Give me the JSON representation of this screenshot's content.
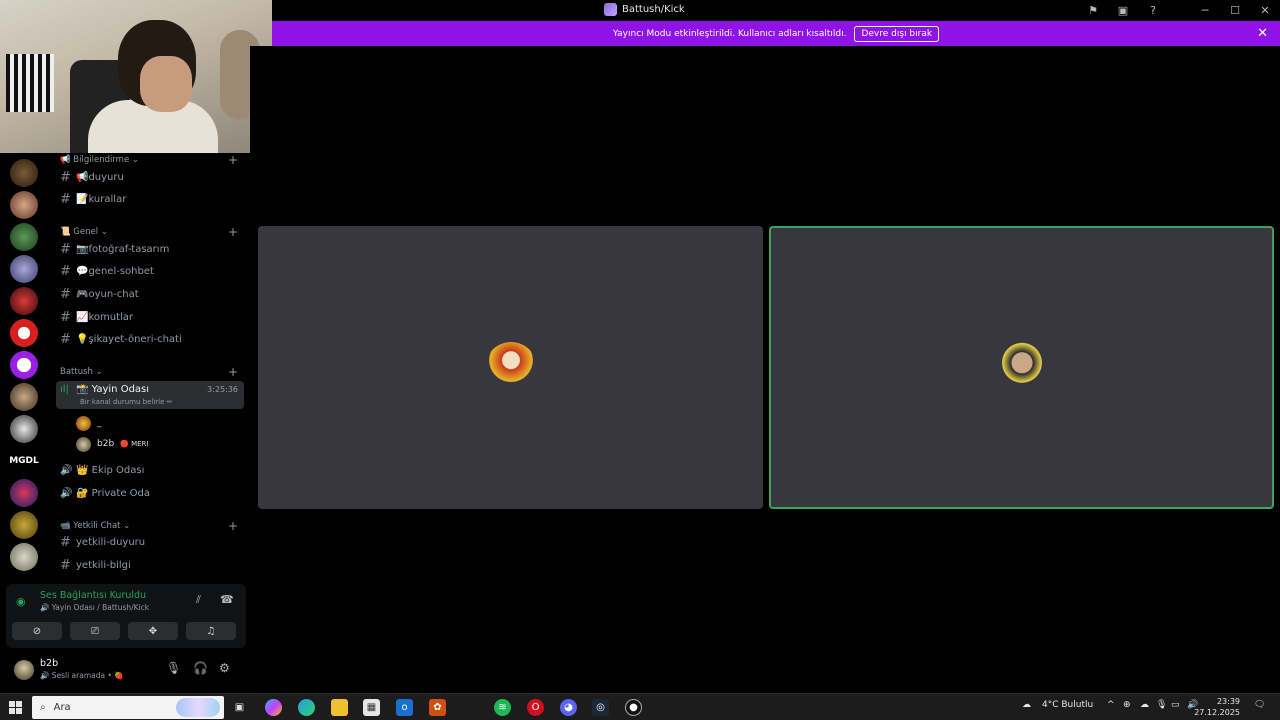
{
  "window": {
    "title": "Battush/Kick"
  },
  "banner": {
    "message": "Yayıncı Modu etkinleştirildi. Kullanıcı adları kısaltıldı.",
    "button": "Devre dışı bırak",
    "close": "✕"
  },
  "titlebar_icons": {
    "inbox": "⚑",
    "screen": "▣",
    "help": "?",
    "min": "─",
    "max": "☐",
    "close": "✕"
  },
  "sidebar": {
    "categories": {
      "bilgilendirme": "📢 Bilgilendirme ⌄",
      "genel": "📜 Genel ⌄",
      "battush": "Battush ⌄",
      "yetkili": "📹 Yetkili Chat ⌄"
    },
    "channels": {
      "duyuru": "📢duyuru",
      "kurallar": "📝kurallar",
      "fotograf": "📷fotoğraf-tasarım",
      "genel_sohbet": "💬genel-sohbet",
      "oyun_chat": "🎮oyun-chat",
      "komutlar": "📈komutlar",
      "sikayet": "💡şikayet-öneri-chati",
      "yayin_odasi": "📸 Yayin Odası",
      "yayin_sub": "Bir kanal durumu belirle ✏",
      "yayin_time": "3:25:36",
      "ekip_odasi": "👑 Ekip Odası",
      "private_oda": "🔐 Private Oda",
      "yetkili_duyuru": "yetkili-duyuru",
      "yetkili_bilgi": "yetkili-bilgi"
    },
    "members": [
      {
        "name": "_",
        "tag": ""
      },
      {
        "name": "b2b",
        "tag": "🔴 MERI"
      }
    ]
  },
  "voice": {
    "status": "Ses Bağlantısı Kuruldu",
    "location": "🔊 Yayin Odası / Battush/Kick"
  },
  "user": {
    "name": "b2b",
    "status": "🔊 Sesli aramada • 🍓"
  },
  "taskbar": {
    "search": "Ara",
    "weather": "4°C  Bulutlu",
    "time": "23:39",
    "date": "27.12.2025"
  }
}
